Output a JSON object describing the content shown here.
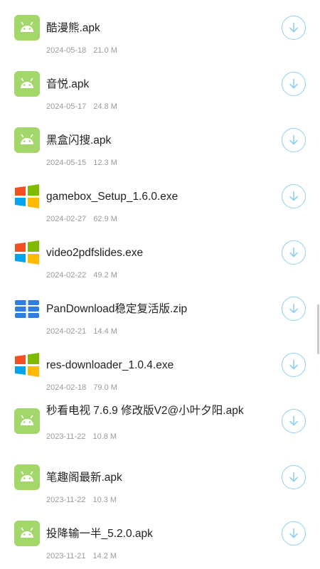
{
  "files": [
    {
      "name": "酷漫熊.apk",
      "date": "2024-05-18",
      "size": "21.0 M",
      "type": "android-icon"
    },
    {
      "name": "音悦.apk",
      "date": "2024-05-17",
      "size": "24.8 M",
      "type": "android-icon"
    },
    {
      "name": "黑盒闪搜.apk",
      "date": "2024-05-15",
      "size": "12.3 M",
      "type": "android-icon"
    },
    {
      "name": "gamebox_Setup_1.6.0.exe",
      "date": "2024-02-27",
      "size": "62.9 M",
      "type": "windows-icon"
    },
    {
      "name": "video2pdfslides.exe",
      "date": "2024-02-22",
      "size": "49.2 M",
      "type": "windows-icon"
    },
    {
      "name": "PanDownload稳定复活版.zip",
      "date": "2024-02-21",
      "size": "14.4 M",
      "type": "archive-icon"
    },
    {
      "name": "res-downloader_1.0.4.exe",
      "date": "2024-02-18",
      "size": "79.0 M",
      "type": "windows-icon"
    },
    {
      "name": "秒看电视 7.6.9 修改版V2@小叶夕阳.apk",
      "date": "2023-11-22",
      "size": "10.8 M",
      "type": "android-icon"
    },
    {
      "name": "笔趣阁最新.apk",
      "date": "2023-11-22",
      "size": "10.3 M",
      "type": "android-icon"
    },
    {
      "name": "投降输一半_5.2.0.apk",
      "date": "2023-11-21",
      "size": "14.2 M",
      "type": "android-icon"
    }
  ],
  "colors": {
    "android": "#a4d769",
    "win_red": "#f25022",
    "win_green": "#7fba00",
    "win_blue": "#00a4ef",
    "win_yellow": "#ffb900",
    "archive": "#2f7de1",
    "download_accent": "#8fd0ee"
  },
  "download_icon": "download-arrow-icon"
}
